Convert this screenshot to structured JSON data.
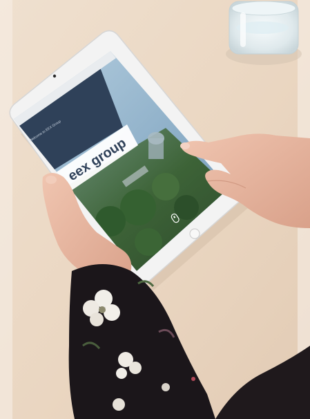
{
  "photo": {
    "subject": "tablet-with-website-in-hands",
    "colors": {
      "table": "#ead9c6",
      "tablet_frame": "#f4f4f4",
      "screen_dark": "#2f4159",
      "sky": "#8fb4cf",
      "foliage": "#3f6a3a",
      "skin": "#e9b9a3",
      "sleeve": "#1b161a",
      "flower": "#f1efe9"
    }
  },
  "screen": {
    "logo_text": "eex group",
    "welcome_text": "Welcome to EEX Group"
  }
}
